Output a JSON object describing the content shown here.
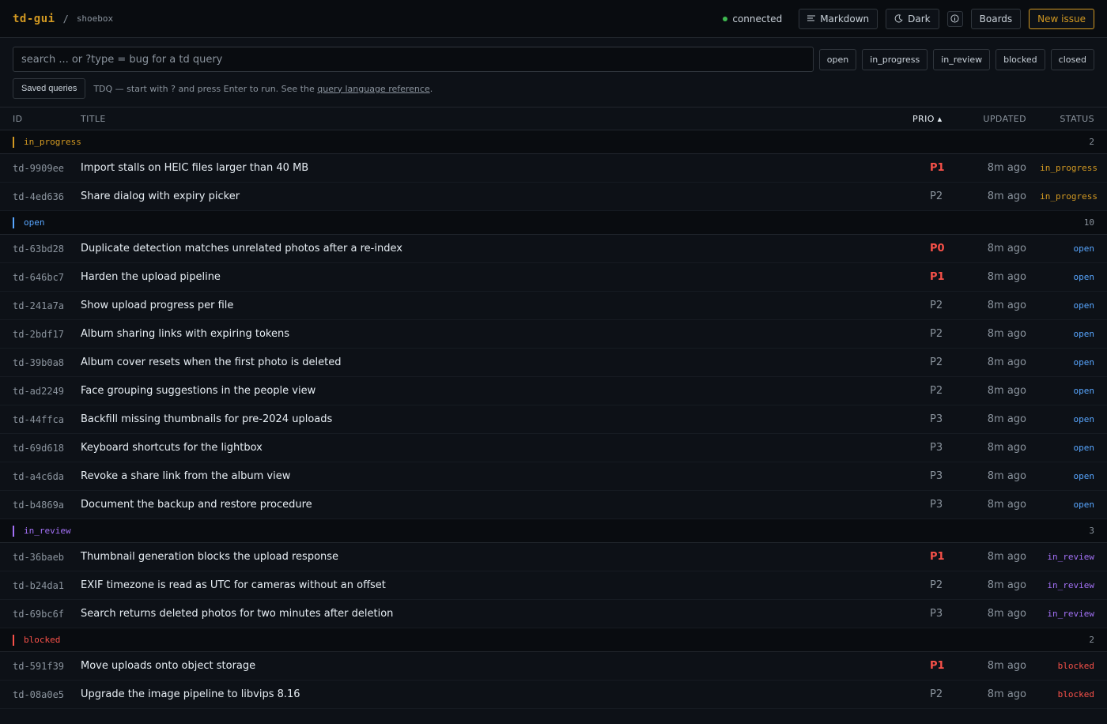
{
  "header": {
    "brand": "td-gui",
    "separator": "/",
    "project": "shoebox",
    "connection": "connected",
    "buttons": {
      "markdown": "Markdown",
      "theme": "Dark",
      "info_icon": "info-icon",
      "boards": "Boards",
      "new_issue": "New issue"
    }
  },
  "search": {
    "placeholder": "search ... or ?type = bug for a td query",
    "value": "",
    "chips": [
      "open",
      "in_progress",
      "in_review",
      "blocked",
      "closed"
    ]
  },
  "help": {
    "saved_queries": "Saved queries",
    "text": "TDQ — start with ? and press Enter to run. See the",
    "link": "query language reference",
    "end": "."
  },
  "table": {
    "columns": {
      "id": "ID",
      "title": "TITLE",
      "prio": "PRIO ▴",
      "updated": "UPDATED",
      "status": "STATUS"
    }
  },
  "groups": [
    {
      "name": "in_progress",
      "count": "2",
      "color": "#d29922",
      "rows": [
        {
          "id": "td-9909ee",
          "title": "Import stalls on HEIC files larger than 40 MB",
          "prio": "P1",
          "updated": "8m ago",
          "status": "in_progress"
        },
        {
          "id": "td-4ed636",
          "title": "Share dialog with expiry picker",
          "prio": "P2",
          "updated": "8m ago",
          "status": "in_progress"
        }
      ]
    },
    {
      "name": "open",
      "count": "10",
      "color": "#58a6ff",
      "rows": [
        {
          "id": "td-63bd28",
          "title": "Duplicate detection matches unrelated photos after a re-index",
          "prio": "P0",
          "updated": "8m ago",
          "status": "open"
        },
        {
          "id": "td-646bc7",
          "title": "Harden the upload pipeline",
          "prio": "P1",
          "updated": "8m ago",
          "status": "open"
        },
        {
          "id": "td-241a7a",
          "title": "Show upload progress per file",
          "prio": "P2",
          "updated": "8m ago",
          "status": "open"
        },
        {
          "id": "td-2bdf17",
          "title": "Album sharing links with expiring tokens",
          "prio": "P2",
          "updated": "8m ago",
          "status": "open"
        },
        {
          "id": "td-39b0a8",
          "title": "Album cover resets when the first photo is deleted",
          "prio": "P2",
          "updated": "8m ago",
          "status": "open"
        },
        {
          "id": "td-ad2249",
          "title": "Face grouping suggestions in the people view",
          "prio": "P2",
          "updated": "8m ago",
          "status": "open"
        },
        {
          "id": "td-44ffca",
          "title": "Backfill missing thumbnails for pre-2024 uploads",
          "prio": "P3",
          "updated": "8m ago",
          "status": "open"
        },
        {
          "id": "td-69d618",
          "title": "Keyboard shortcuts for the lightbox",
          "prio": "P3",
          "updated": "8m ago",
          "status": "open"
        },
        {
          "id": "td-a4c6da",
          "title": "Revoke a share link from the album view",
          "prio": "P3",
          "updated": "8m ago",
          "status": "open"
        },
        {
          "id": "td-b4869a",
          "title": "Document the backup and restore procedure",
          "prio": "P3",
          "updated": "8m ago",
          "status": "open"
        }
      ]
    },
    {
      "name": "in_review",
      "count": "3",
      "color": "#a371f7",
      "rows": [
        {
          "id": "td-36baeb",
          "title": "Thumbnail generation blocks the upload response",
          "prio": "P1",
          "updated": "8m ago",
          "status": "in_review"
        },
        {
          "id": "td-b24da1",
          "title": "EXIF timezone is read as UTC for cameras without an offset",
          "prio": "P2",
          "updated": "8m ago",
          "status": "in_review"
        },
        {
          "id": "td-69bc6f",
          "title": "Search returns deleted photos for two minutes after deletion",
          "prio": "P3",
          "updated": "8m ago",
          "status": "in_review"
        }
      ]
    },
    {
      "name": "blocked",
      "count": "2",
      "color": "#f85149",
      "rows": [
        {
          "id": "td-591f39",
          "title": "Move uploads onto object storage",
          "prio": "P1",
          "updated": "8m ago",
          "status": "blocked"
        },
        {
          "id": "td-08a0e5",
          "title": "Upgrade the image pipeline to libvips 8.16",
          "prio": "P2",
          "updated": "8m ago",
          "status": "blocked"
        }
      ]
    }
  ]
}
